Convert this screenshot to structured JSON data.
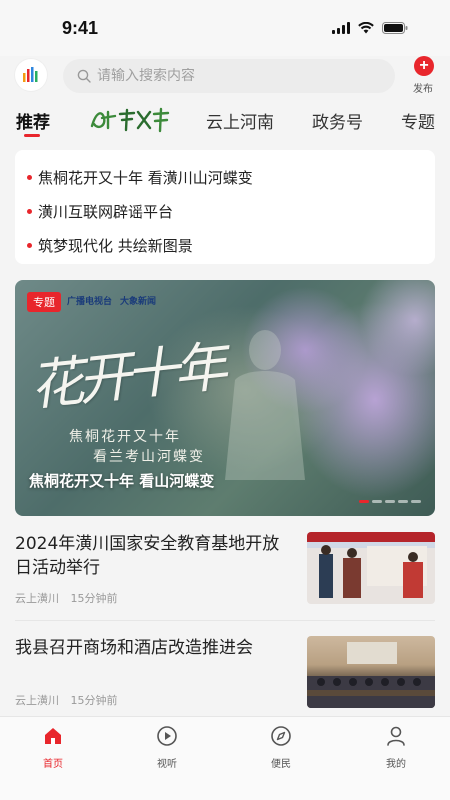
{
  "status": {
    "time": "9:41"
  },
  "search": {
    "placeholder": "请输入搜索内容"
  },
  "publish": {
    "label": "发布"
  },
  "tabs": [
    {
      "label": "推荐",
      "active": true
    },
    {
      "label": "花开十年"
    },
    {
      "label": "云上河南"
    },
    {
      "label": "政务号"
    },
    {
      "label": "专题"
    }
  ],
  "headlines": [
    "焦桐花开又十年 看潢川山河蝶变",
    "潢川互联网辟谣平台",
    "筑梦现代化 共绘新图景"
  ],
  "banner": {
    "tag": "专题",
    "logos": [
      "广播电视台",
      "大象新闻"
    ],
    "big_title": "花开十年",
    "subtitle_line1": "焦桐花开又十年",
    "subtitle_line2": "看兰考山河蝶变",
    "caption": "焦桐花开又十年 看山河蝶变",
    "slide_count": 5,
    "active_slide": 1
  },
  "news": [
    {
      "title": "2024年潢川国家安全教育基地开放日活动举行",
      "source": "云上潢川",
      "time": "15分钟前"
    },
    {
      "title": "我县召开商场和酒店改造推进会",
      "source": "云上潢川",
      "time": "15分钟前"
    }
  ],
  "bottom_nav": [
    {
      "label": "首页",
      "icon": "home-icon",
      "active": true
    },
    {
      "label": "视听",
      "icon": "play-icon"
    },
    {
      "label": "便民",
      "icon": "compass-icon"
    },
    {
      "label": "我的",
      "icon": "user-icon"
    }
  ],
  "colors": {
    "accent": "#e8262c"
  }
}
